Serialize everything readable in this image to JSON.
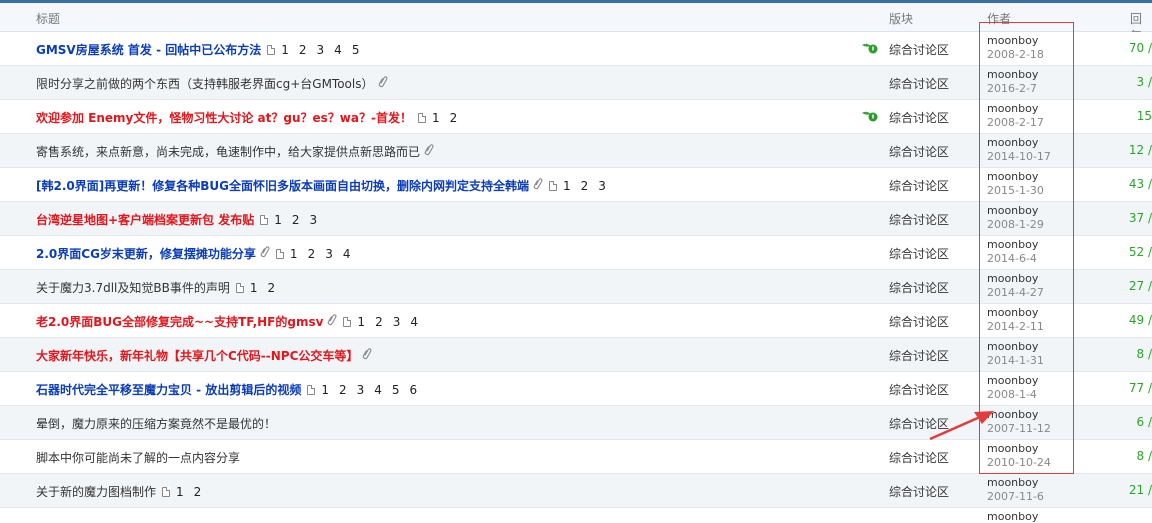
{
  "header": {
    "title": "标题",
    "forum": "版块",
    "author": "作者",
    "replies": "回复"
  },
  "rows": [
    {
      "title": "GMSV房屋系统 首发 - 回帖中已公布方法",
      "style": "blue",
      "clip": false,
      "pages": [
        "1",
        "2",
        "3",
        "4",
        "5"
      ],
      "hot": true,
      "forum": "综合讨论区",
      "author": "moonboy",
      "date": "2008-2-18",
      "replies": "70 /"
    },
    {
      "title": "限时分享之前做的两个东西（支持韩服老界面cg+台GMTools）",
      "style": "normal",
      "clip": true,
      "pages": [],
      "hot": false,
      "forum": "综合讨论区",
      "author": "moonboy",
      "date": "2016-2-7",
      "replies": "3 /"
    },
    {
      "title": "欢迎参加 Enemy文件，怪物习性大讨论 at？gu？es？wa？-首发！",
      "style": "red",
      "clip": false,
      "pages": [
        "1",
        "2"
      ],
      "hot": true,
      "forum": "综合讨论区",
      "author": "moonboy",
      "date": "2008-2-17",
      "replies": "15"
    },
    {
      "title": "寄售系统，来点新意，尚未完成，龟速制作中，给大家提供点新思路而已",
      "style": "normal",
      "clip": true,
      "pages": [],
      "hot": false,
      "forum": "综合讨论区",
      "author": "moonboy",
      "date": "2014-10-17",
      "replies": "12 /"
    },
    {
      "title": "[韩2.0界面]再更新！修复各种BUG全面怀旧多版本画面自由切换，删除内网判定支持全韩端",
      "style": "blue",
      "clip": true,
      "pages": [
        "1",
        "2",
        "3"
      ],
      "hot": false,
      "forum": "综合讨论区",
      "author": "moonboy",
      "date": "2015-1-30",
      "replies": "43 /"
    },
    {
      "title": "台湾逆星地图+客户端档案更新包 发布贴",
      "style": "red",
      "clip": false,
      "pages": [
        "1",
        "2",
        "3"
      ],
      "hot": false,
      "forum": "综合讨论区",
      "author": "moonboy",
      "date": "2008-1-29",
      "replies": "37 /"
    },
    {
      "title": "2.0界面CG岁末更新，修复摆摊功能分享",
      "style": "blue",
      "clip": true,
      "pages": [
        "1",
        "2",
        "3",
        "4"
      ],
      "hot": false,
      "forum": "综合讨论区",
      "author": "moonboy",
      "date": "2014-6-4",
      "replies": "52 /"
    },
    {
      "title": "关于魔力3.7dll及知觉BB事件的声明",
      "style": "normal",
      "clip": false,
      "pages": [
        "1",
        "2"
      ],
      "hot": false,
      "forum": "综合讨论区",
      "author": "moonboy",
      "date": "2014-4-27",
      "replies": "27 /"
    },
    {
      "title": "老2.0界面BUG全部修复完成~~支持TF,HF的gmsv",
      "style": "red",
      "clip": true,
      "pages": [
        "1",
        "2",
        "3",
        "4"
      ],
      "hot": false,
      "forum": "综合讨论区",
      "author": "moonboy",
      "date": "2014-2-11",
      "replies": "49 /"
    },
    {
      "title": "大家新年快乐，新年礼物【共享几个C代码--NPC公交车等】",
      "style": "red",
      "clip": true,
      "pages": [],
      "hot": false,
      "forum": "综合讨论区",
      "author": "moonboy",
      "date": "2014-1-31",
      "replies": "8 /"
    },
    {
      "title": "石器时代完全平移至魔力宝贝 - 放出剪辑后的视频",
      "style": "blue",
      "clip": false,
      "pages": [
        "1",
        "2",
        "3",
        "4",
        "5",
        "6"
      ],
      "hot": false,
      "forum": "综合讨论区",
      "author": "moonboy",
      "date": "2008-1-4",
      "replies": "77 /"
    },
    {
      "title": "晕倒，魔力原来的压缩方案竟然不是最优的！",
      "style": "normal",
      "clip": false,
      "pages": [],
      "hot": false,
      "forum": "综合讨论区",
      "author": "moonboy",
      "date": "2007-11-12",
      "replies": "6 /"
    },
    {
      "title": "脚本中你可能尚未了解的一点内容分享",
      "style": "normal",
      "clip": false,
      "pages": [],
      "hot": false,
      "forum": "综合讨论区",
      "author": "moonboy",
      "date": "2010-10-24",
      "replies": "8 /"
    },
    {
      "title": "关于新的魔力图档制作",
      "style": "normal",
      "clip": false,
      "pages": [
        "1",
        "2"
      ],
      "hot": false,
      "forum": "综合讨论区",
      "author": "moonboy",
      "date": "2007-11-6",
      "replies": "21 /"
    }
  ],
  "tail_author": "moonboy",
  "colors": {
    "blue_title": "#0b3db8",
    "red_title": "#e4161c",
    "reply_green": "#2aa52a",
    "annotation": "#e23c3c"
  }
}
